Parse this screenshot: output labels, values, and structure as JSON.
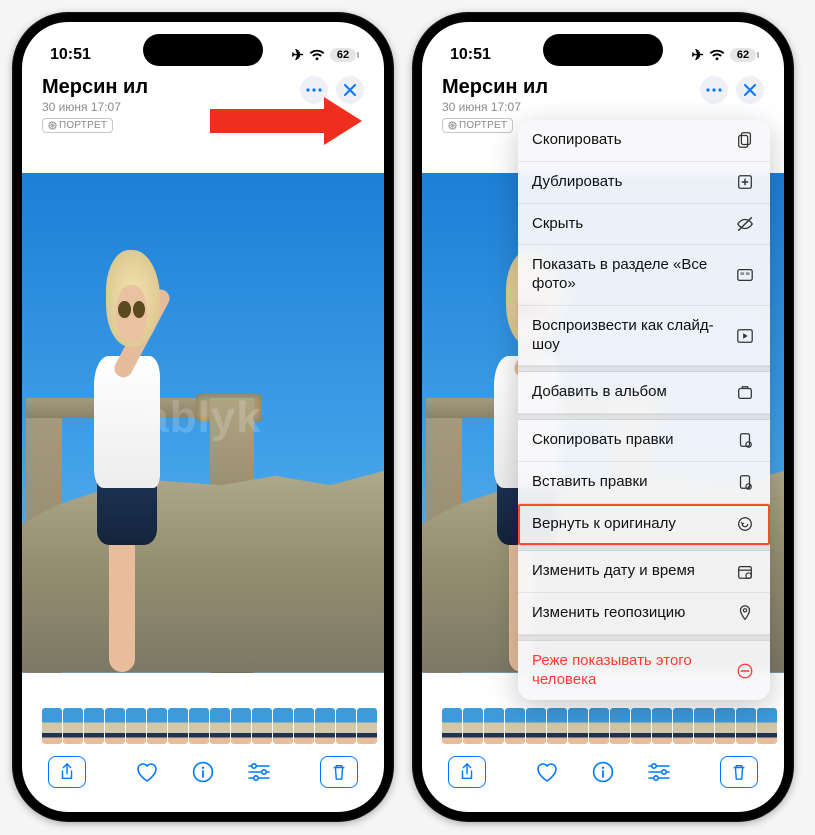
{
  "status": {
    "time": "10:51",
    "battery": "62"
  },
  "header": {
    "title": "Мерсин ил",
    "subtitle": "30 июня 17:07",
    "badge": "ПОРТРЕТ"
  },
  "watermark": "ablyk",
  "thumbs_count": 16,
  "menu": {
    "groups": [
      [
        {
          "label": "Скопировать",
          "icon": "copy"
        },
        {
          "label": "Дублировать",
          "icon": "duplicate"
        },
        {
          "label": "Скрыть",
          "icon": "hide"
        },
        {
          "label": "Показать в разделе «Все фото»",
          "icon": "grid"
        },
        {
          "label": "Воспроизвести как слайд-шоу",
          "icon": "play"
        }
      ],
      [
        {
          "label": "Добавить в альбом",
          "icon": "album"
        }
      ],
      [
        {
          "label": "Скопировать правки",
          "icon": "copy-edits"
        },
        {
          "label": "Вставить правки",
          "icon": "paste-edits"
        },
        {
          "label": "Вернуть к оригиналу",
          "icon": "revert",
          "highlight": true
        }
      ],
      [
        {
          "label": "Изменить дату и время",
          "icon": "calendar"
        },
        {
          "label": "Изменить геопозицию",
          "icon": "pin"
        }
      ],
      [
        {
          "label": "Реже показывать этого человека",
          "icon": "minus",
          "destructive": true
        }
      ]
    ]
  }
}
